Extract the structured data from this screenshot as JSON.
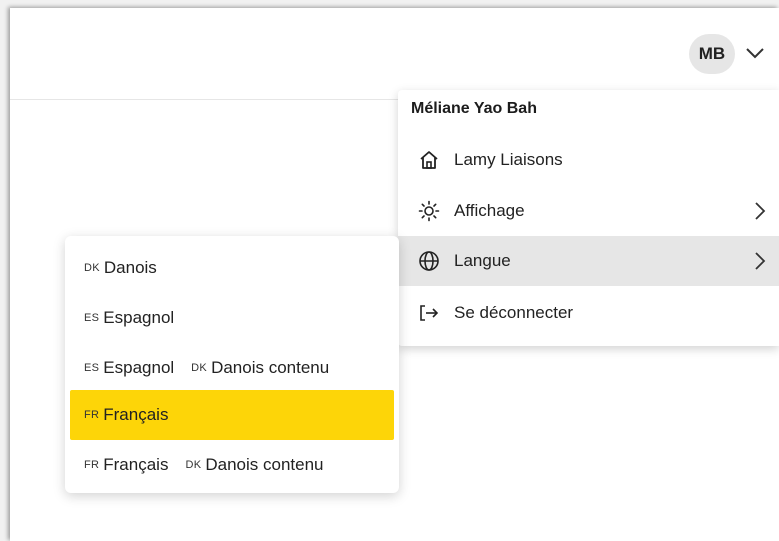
{
  "header": {
    "avatar_initials": "MB"
  },
  "user_menu": {
    "user_name": "Méliane Yao Bah",
    "items": [
      {
        "label": "Lamy Liaisons",
        "icon": "home-icon"
      },
      {
        "label": "Affichage",
        "icon": "sun-icon",
        "has_submenu": true
      },
      {
        "label": "Langue",
        "icon": "globe-icon",
        "has_submenu": true,
        "active": true
      },
      {
        "label": "Se déconnecter",
        "icon": "logout-icon"
      }
    ]
  },
  "language_menu": {
    "items": [
      {
        "code": "DK",
        "label": "Danois"
      },
      {
        "code": "ES",
        "label": "Espagnol"
      },
      {
        "code": "ES",
        "label": "Espagnol",
        "content_code": "DK",
        "content_label": "Danois contenu"
      },
      {
        "code": "FR",
        "label": "Français",
        "selected": true
      },
      {
        "code": "FR",
        "label": "Français",
        "content_code": "DK",
        "content_label": "Danois contenu"
      }
    ]
  },
  "colors": {
    "selected": "#fdd508",
    "hover": "#e6e6e6",
    "avatar_bg": "#e6e6e6"
  }
}
